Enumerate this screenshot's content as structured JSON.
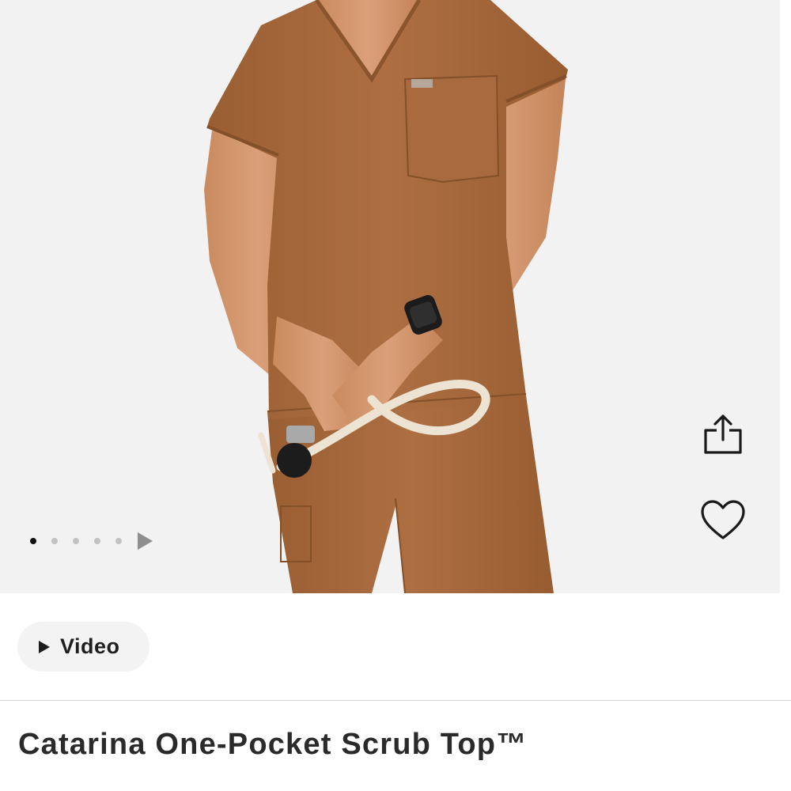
{
  "gallery": {
    "image_alt": "Model wearing brown one-pocket scrub top and pants, holding a stethoscope",
    "dots_total": 5,
    "active_dot": 0,
    "next_icon": "play-arrow-icon",
    "background_color": "#f2f2f2",
    "garment_color": "#a5683c"
  },
  "actions": {
    "share_icon": "share-icon",
    "wishlist_icon": "heart-icon"
  },
  "video": {
    "label": "Video",
    "icon": "play-icon"
  },
  "product": {
    "title": "Catarina One-Pocket Scrub Top™"
  }
}
